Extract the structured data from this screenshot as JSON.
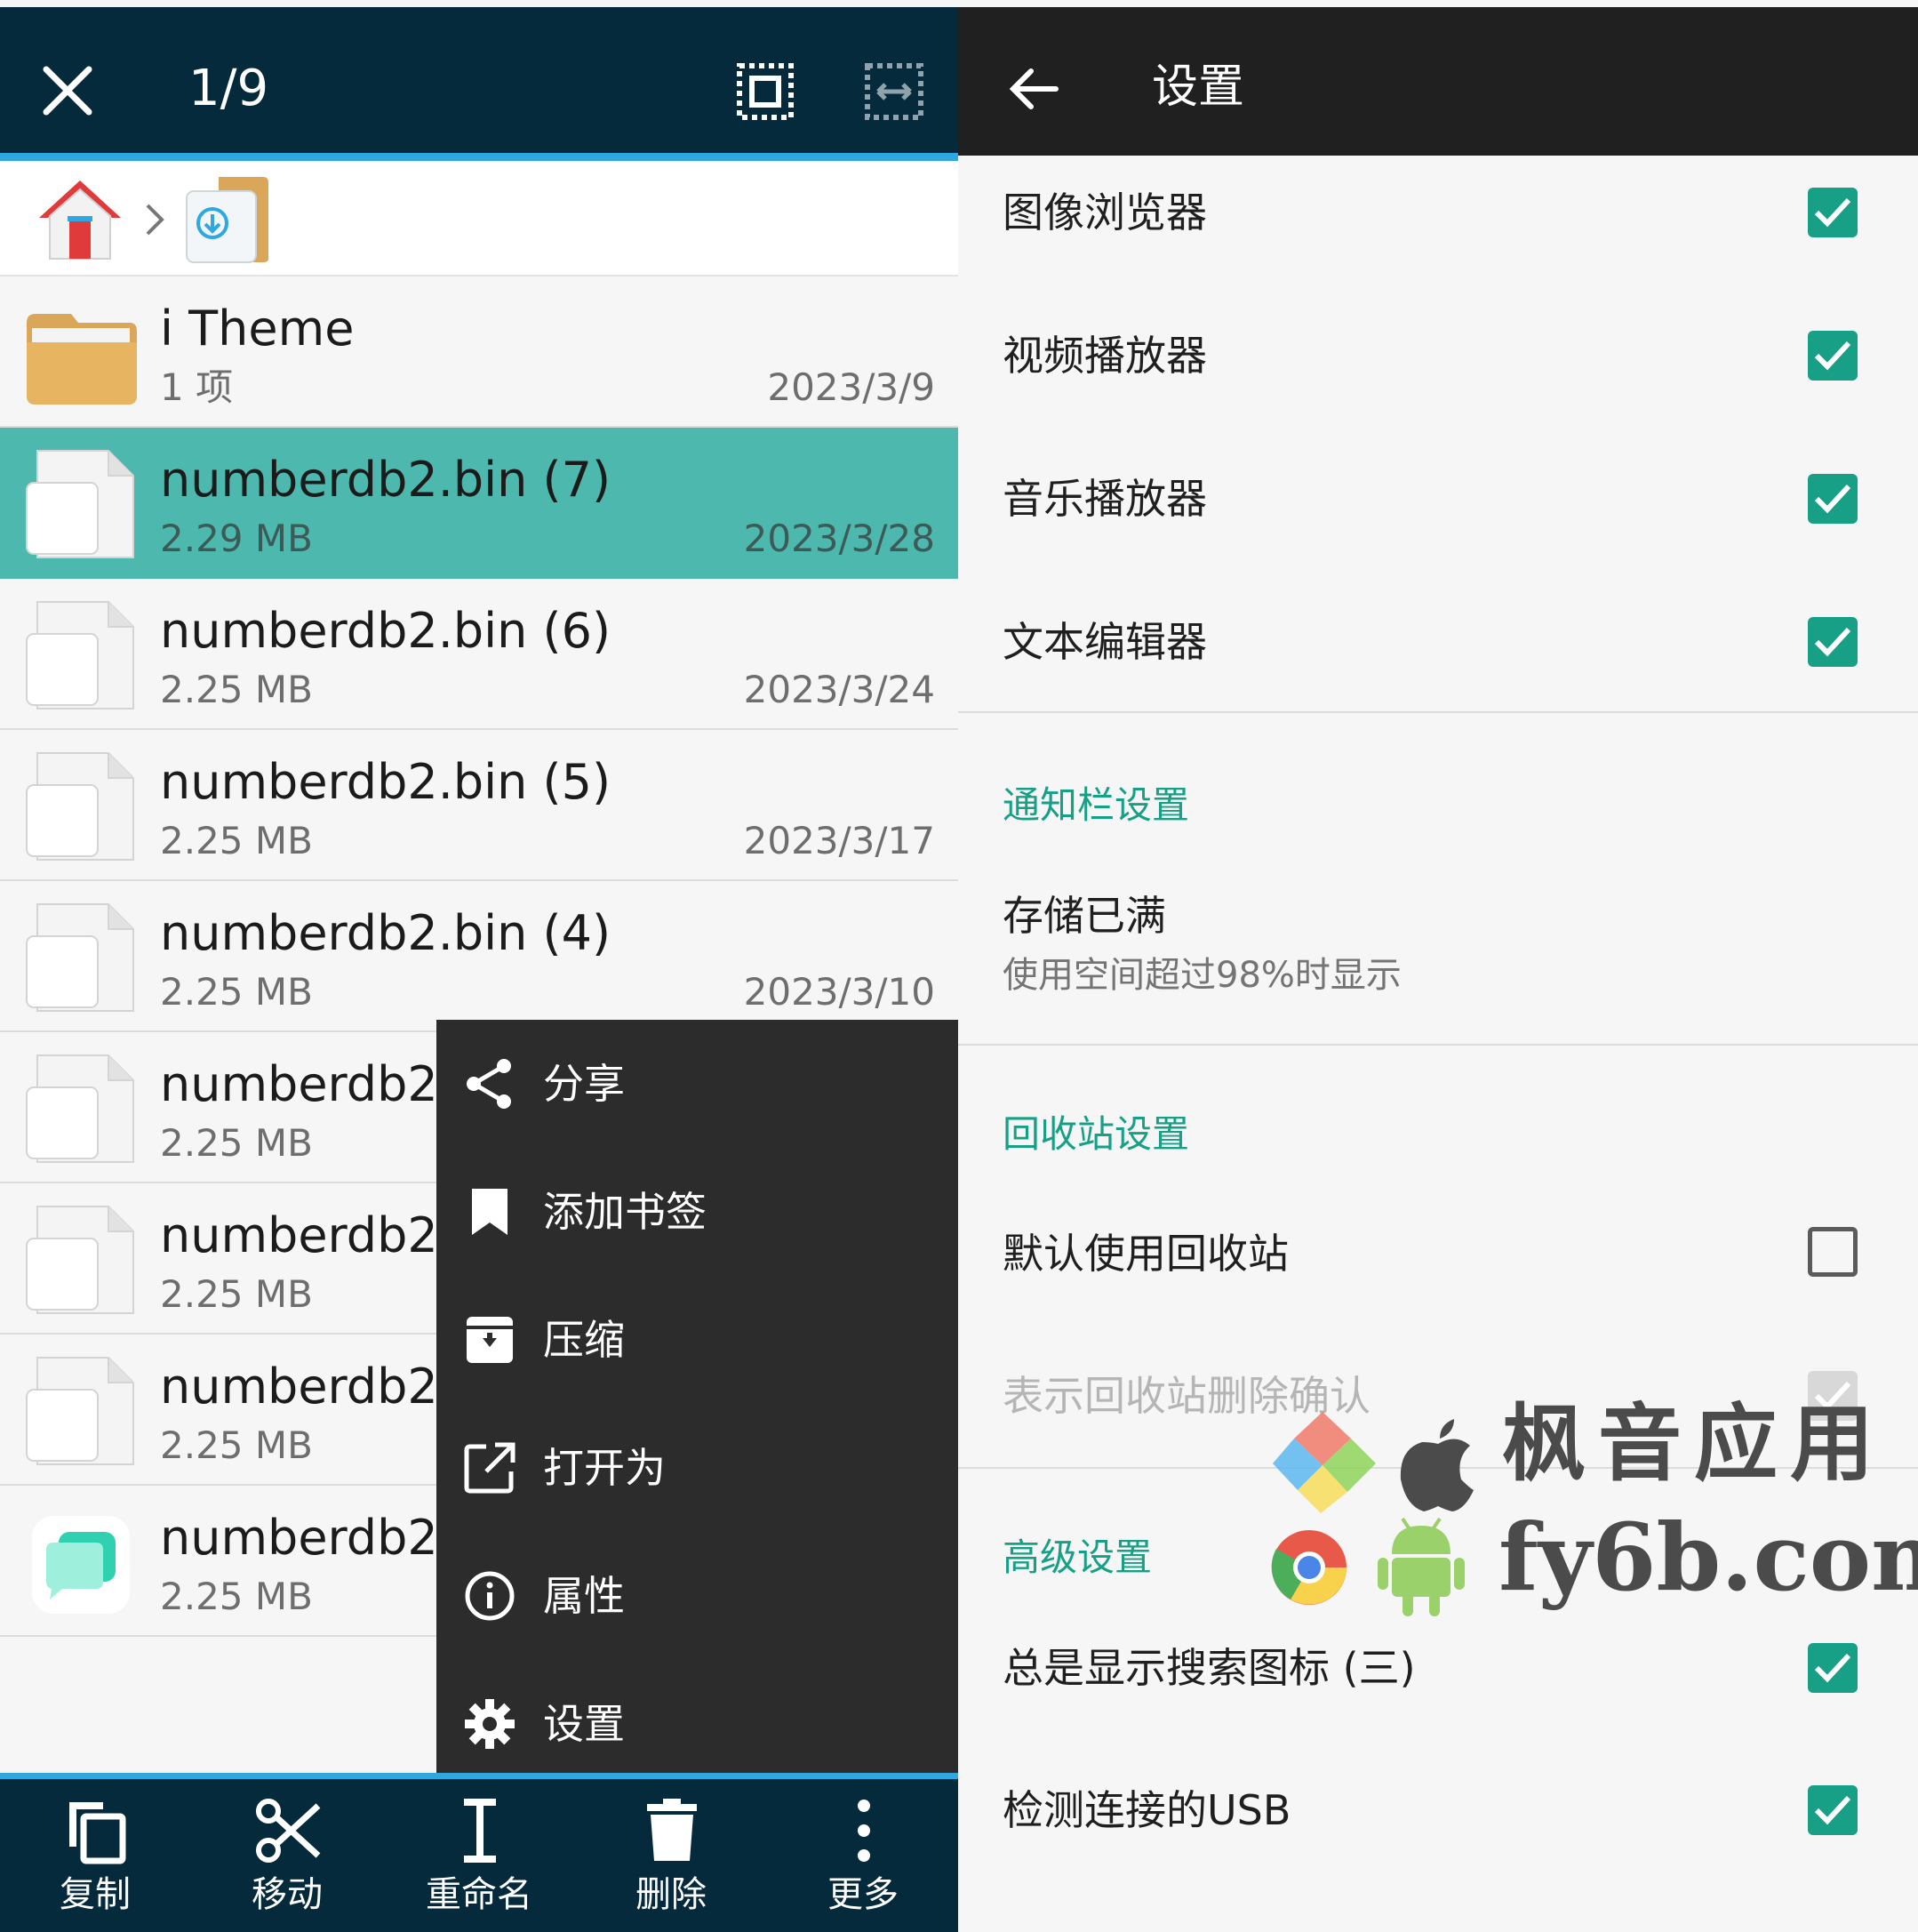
{
  "left": {
    "topbar": {
      "close_icon": "close-icon",
      "selection_count": "1/9",
      "select_all_icon": "select-all-icon",
      "select_range_icon": "select-range-icon",
      "bg_color": "#052a3b",
      "accent_color": "#2fa8e0"
    },
    "breadcrumb": {
      "items": [
        "home-icon",
        "download-folder-icon"
      ]
    },
    "files": [
      {
        "name": "i Theme",
        "size": "1 项",
        "date": "2023/3/9",
        "type": "folder",
        "selected": false
      },
      {
        "name": "numberdb2.bin (7)",
        "size": "2.29 MB",
        "date": "2023/3/28",
        "type": "file",
        "selected": true
      },
      {
        "name": "numberdb2.bin (6)",
        "size": "2.25 MB",
        "date": "2023/3/24",
        "type": "file",
        "selected": false
      },
      {
        "name": "numberdb2.bin (5)",
        "size": "2.25 MB",
        "date": "2023/3/17",
        "type": "file",
        "selected": false
      },
      {
        "name": "numberdb2.bin (4)",
        "size": "2.25 MB",
        "date": "2023/3/10",
        "type": "file",
        "selected": false
      },
      {
        "name": "numberdb2.",
        "size": "2.25 MB",
        "date": "",
        "type": "file",
        "selected": false
      },
      {
        "name": "numberdb2.",
        "size": "2.25 MB",
        "date": "",
        "type": "file",
        "selected": false
      },
      {
        "name": "numberdb2.",
        "size": "2.25 MB",
        "date": "",
        "type": "file",
        "selected": false
      },
      {
        "name": "numberdb2.",
        "size": "2.25 MB",
        "date": "",
        "type": "app",
        "selected": false
      }
    ],
    "context_menu": [
      {
        "label": "分享",
        "icon": "share-icon"
      },
      {
        "label": "添加书签",
        "icon": "bookmark-icon"
      },
      {
        "label": "压缩",
        "icon": "archive-icon"
      },
      {
        "label": "打开为",
        "icon": "open-external-icon"
      },
      {
        "label": "属性",
        "icon": "info-icon"
      },
      {
        "label": "设置",
        "icon": "gear-icon"
      }
    ],
    "bottom_bar": [
      {
        "label": "复制",
        "icon": "copy-icon"
      },
      {
        "label": "移动",
        "icon": "scissors-icon"
      },
      {
        "label": "重命名",
        "icon": "rename-icon"
      },
      {
        "label": "删除",
        "icon": "trash-icon"
      },
      {
        "label": "更多",
        "icon": "more-vertical-icon"
      }
    ]
  },
  "right": {
    "header": {
      "back_icon": "back-arrow-icon",
      "title": "设置",
      "bg_color": "#202020"
    },
    "accent_color": "#17a086",
    "prefs_top": [
      {
        "title": "图像浏览器",
        "checked": true
      },
      {
        "title": "视频播放器",
        "checked": true
      },
      {
        "title": "音乐播放器",
        "checked": true
      },
      {
        "title": "文本编辑器",
        "checked": true
      }
    ],
    "notification_section": {
      "heading": "通知栏设置",
      "item_title": "存储已满",
      "item_summary": "使用空间超过98%时显示"
    },
    "recycle_section": {
      "heading": "回收站设置",
      "items": [
        {
          "title": "默认使用回收站",
          "checked": false,
          "enabled": true
        },
        {
          "title": "表示回收站删除确认",
          "checked": true,
          "enabled": false
        }
      ]
    },
    "advanced_section": {
      "heading": "高级设置",
      "items": [
        {
          "title": "总是显示搜索图标 (三)",
          "checked": true
        },
        {
          "title": "检测连接的USB",
          "checked": true
        }
      ]
    }
  },
  "watermark": {
    "brand": "枫音应用",
    "url": "fy6b.com"
  }
}
